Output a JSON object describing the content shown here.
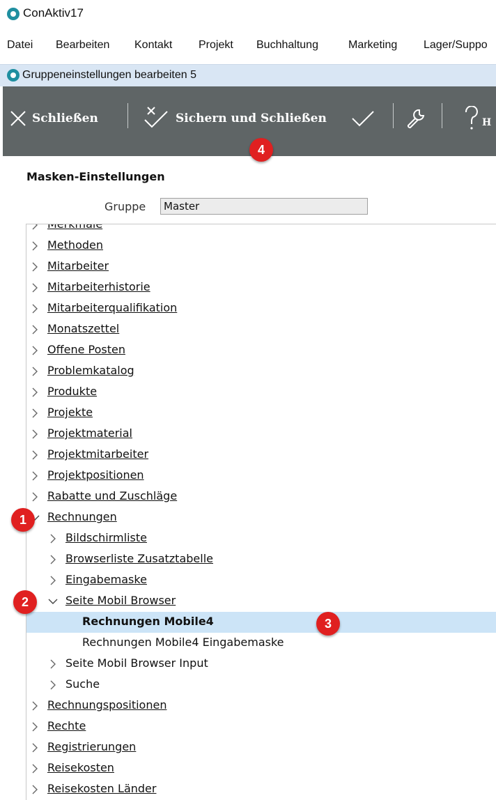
{
  "app": {
    "title": "ConAktiv17"
  },
  "menu": [
    "Datei",
    "Bearbeiten",
    "Kontakt",
    "Projekt",
    "Buchhaltung",
    "Marketing",
    "Lager/Suppo"
  ],
  "dialog": {
    "title": "Gruppeneinstellungen bearbeiten 5"
  },
  "toolbar": {
    "close_label": "Schließen",
    "save_close_label": "Sichern und Schließen",
    "help_label": "H"
  },
  "form": {
    "section_title": "Masken-Einstellungen",
    "group_label": "Gruppe",
    "group_value": "Master"
  },
  "tree": {
    "partial_top": "Merkmale",
    "items": [
      "Methoden",
      "Mitarbeiter",
      "Mitarbeiterhistorie",
      "Mitarbeiterqualifikation",
      "Monatszettel",
      "Offene Posten",
      "Problemkatalog",
      "Produkte",
      "Projekte",
      "Projektmaterial",
      "Projektmitarbeiter",
      "Projektpositionen",
      "Rabatte und Zuschläge",
      "Rechnungen",
      "Bildschirmliste",
      "Browserliste Zusatztabelle",
      "Eingabemaske",
      "Seite Mobil Browser",
      "Rechnungen Mobile4",
      "Rechnungen Mobile4 Eingabemaske",
      "Seite Mobil Browser Input",
      "Suche",
      "Rechnungspositionen",
      "Rechte",
      "Registrierungen",
      "Reisekosten",
      "Reisekosten Länder"
    ]
  },
  "badges": [
    "1",
    "2",
    "3",
    "4"
  ],
  "colors": {
    "toolbar_bg": "#5f6566",
    "dialog_bar": "#d9e6f4",
    "selection": "#cce4f7",
    "badge": "#e02020",
    "logo": "#1f8fa0"
  }
}
